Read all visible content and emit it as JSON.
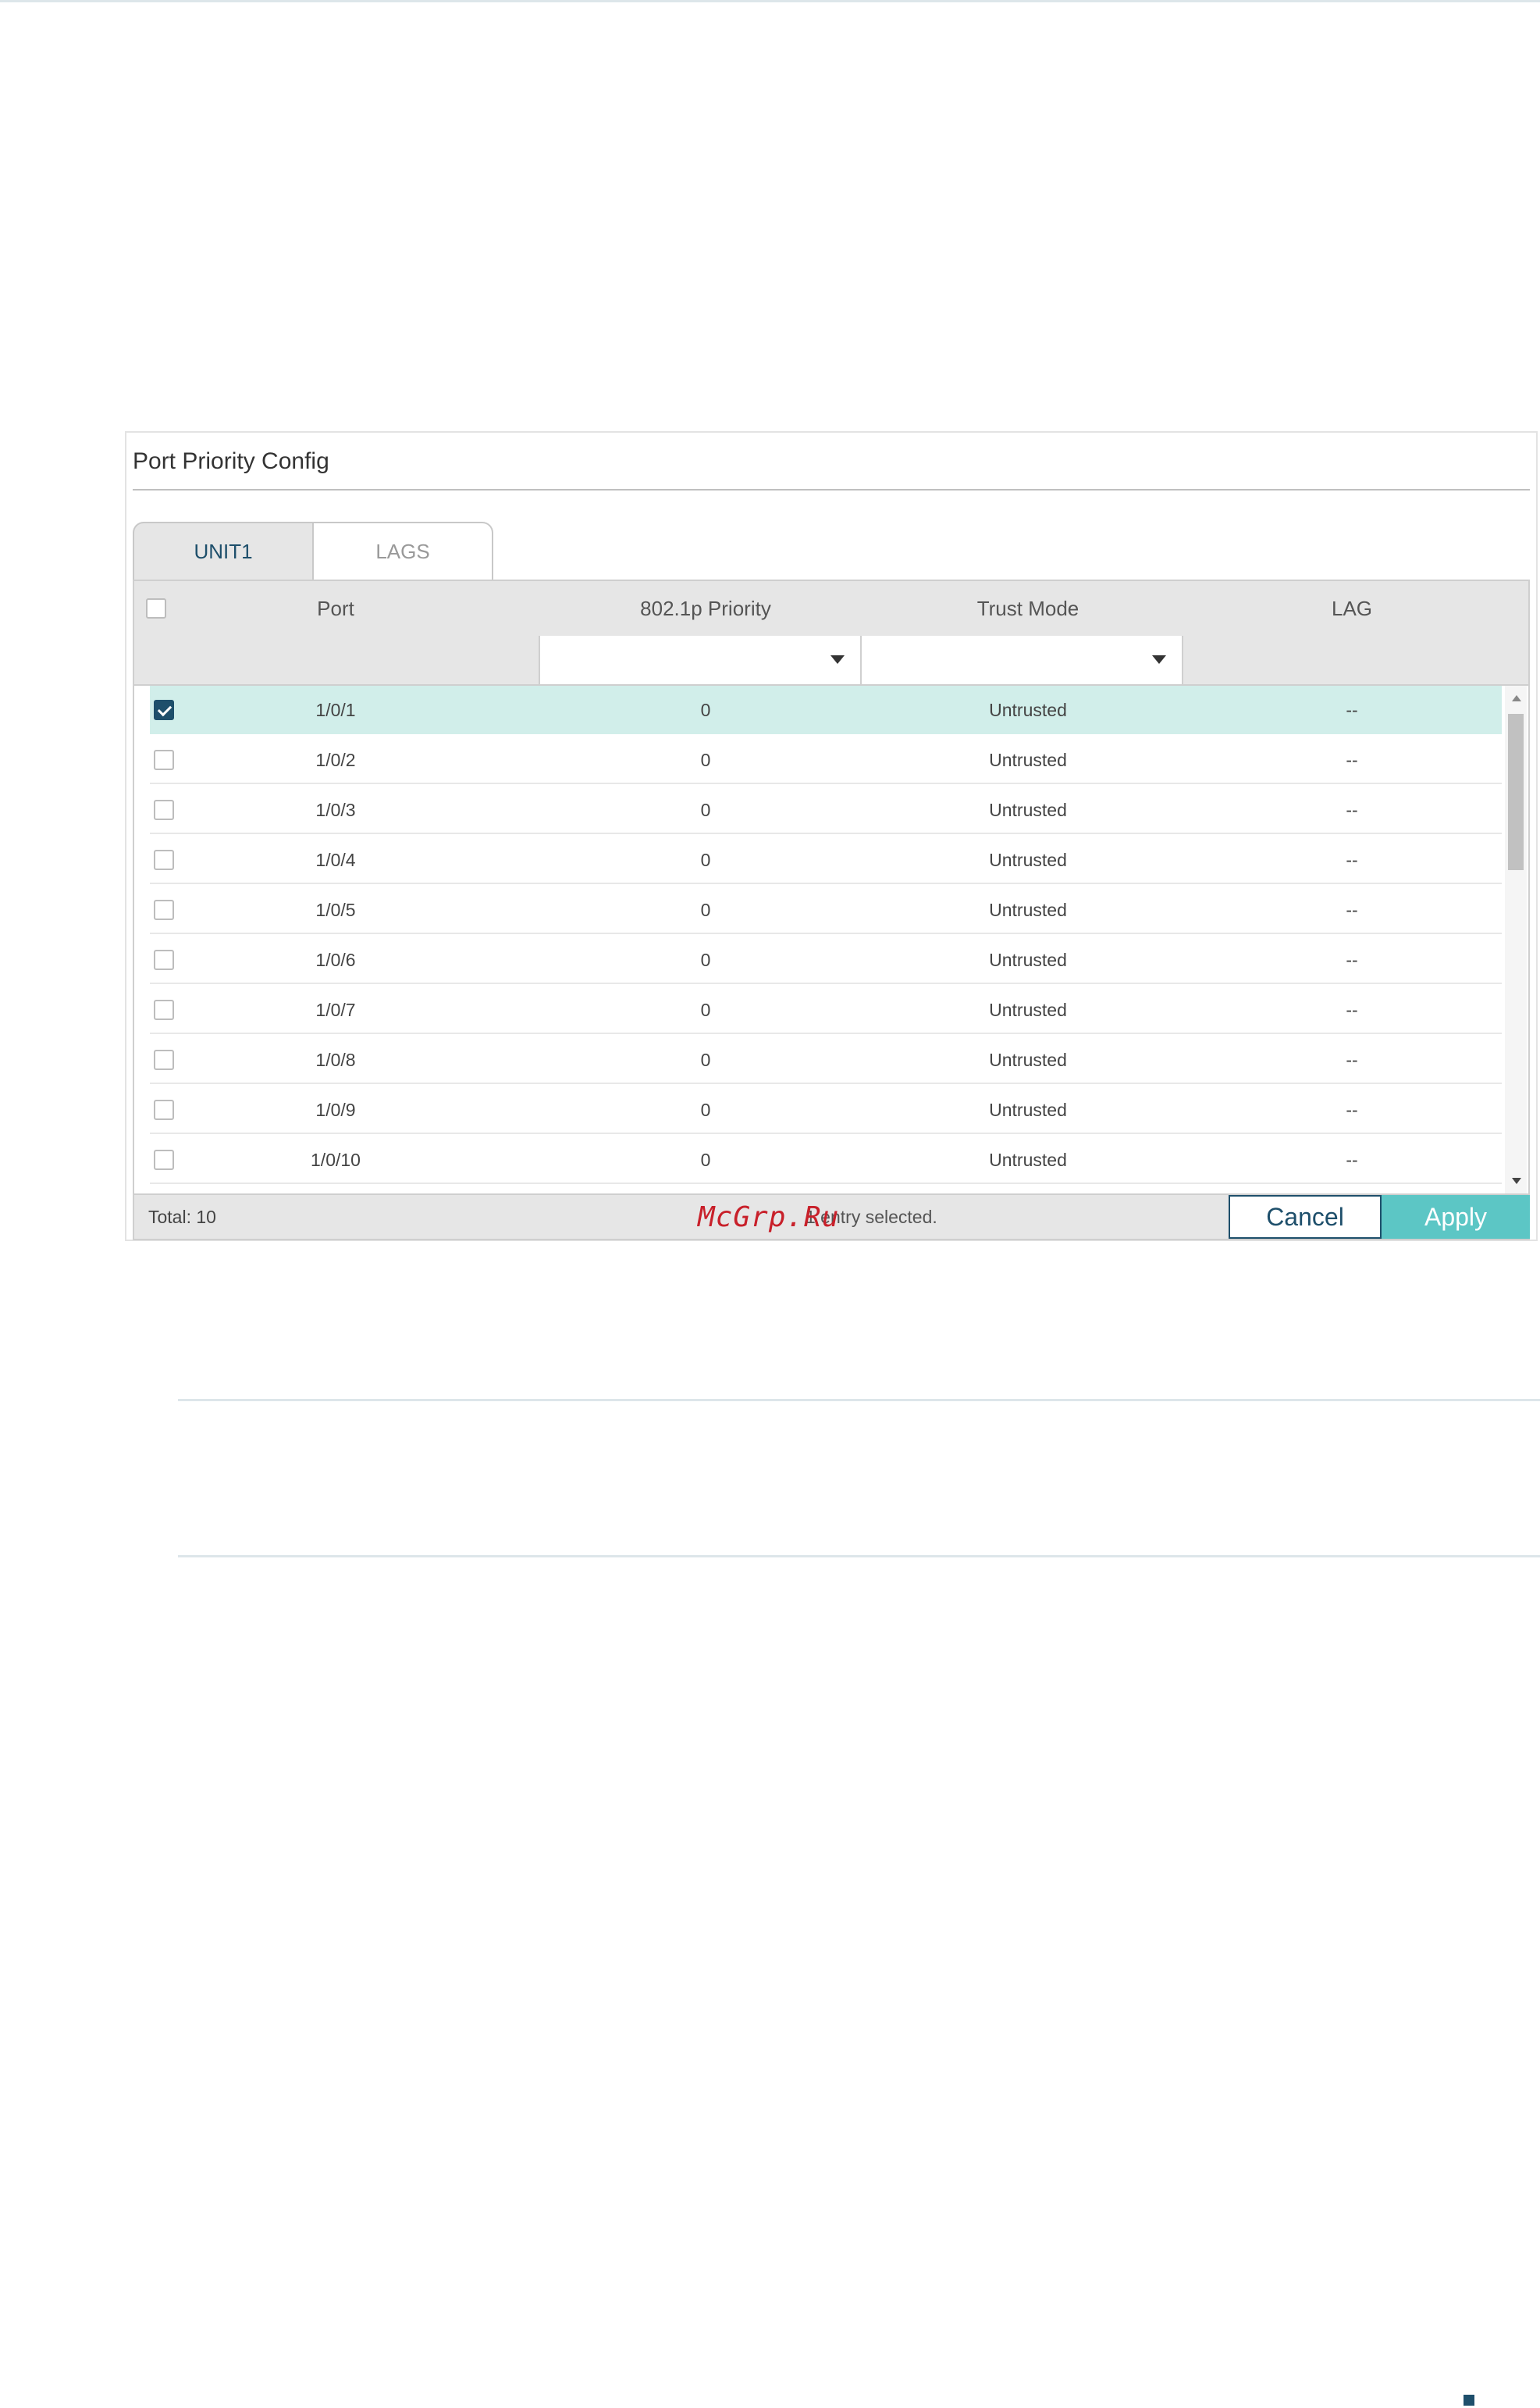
{
  "panel": {
    "title": "Port Priority Config"
  },
  "tabs": [
    {
      "label": "UNIT1",
      "active": true
    },
    {
      "label": "LAGS",
      "active": false
    }
  ],
  "columns": [
    "Port",
    "802.1p Priority",
    "Trust Mode",
    "LAG"
  ],
  "rows": [
    {
      "port": "1/0/1",
      "priority": "0",
      "trust": "Untrusted",
      "lag": "--",
      "checked": true
    },
    {
      "port": "1/0/2",
      "priority": "0",
      "trust": "Untrusted",
      "lag": "--",
      "checked": false
    },
    {
      "port": "1/0/3",
      "priority": "0",
      "trust": "Untrusted",
      "lag": "--",
      "checked": false
    },
    {
      "port": "1/0/4",
      "priority": "0",
      "trust": "Untrusted",
      "lag": "--",
      "checked": false
    },
    {
      "port": "1/0/5",
      "priority": "0",
      "trust": "Untrusted",
      "lag": "--",
      "checked": false
    },
    {
      "port": "1/0/6",
      "priority": "0",
      "trust": "Untrusted",
      "lag": "--",
      "checked": false
    },
    {
      "port": "1/0/7",
      "priority": "0",
      "trust": "Untrusted",
      "lag": "--",
      "checked": false
    },
    {
      "port": "1/0/8",
      "priority": "0",
      "trust": "Untrusted",
      "lag": "--",
      "checked": false
    },
    {
      "port": "1/0/9",
      "priority": "0",
      "trust": "Untrusted",
      "lag": "--",
      "checked": false
    },
    {
      "port": "1/0/10",
      "priority": "0",
      "trust": "Untrusted",
      "lag": "--",
      "checked": false
    }
  ],
  "footer": {
    "total": "Total: 10",
    "selected": "1 entry selected.",
    "watermark": "McGrp.Ru",
    "cancel": "Cancel",
    "apply": "Apply"
  },
  "colors": {
    "accent": "#1e4f6b",
    "apply": "#5cc6c5",
    "selected_row": "#d1eeea"
  },
  "icons": {
    "dropdown": "caret-down-icon",
    "checkbox": "checkbox-icon"
  }
}
